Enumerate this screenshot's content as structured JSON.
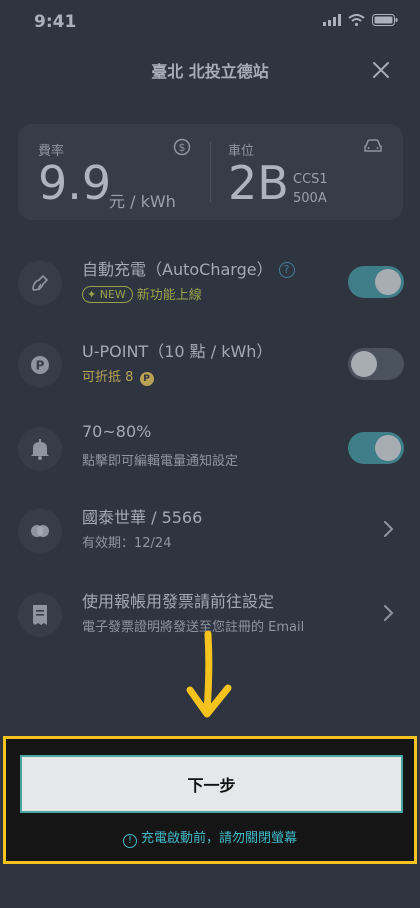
{
  "status_bar": {
    "time": "9:41"
  },
  "header": {
    "title": "臺北 北投立德站"
  },
  "info_card": {
    "rate_label": "費率",
    "rate_value": "9.9",
    "rate_unit": "元 / kWh",
    "slot_label": "車位",
    "slot_value": "2B",
    "connector_type": "CCS1",
    "connector_power": "500A"
  },
  "rows": {
    "autocharge": {
      "title": "自動充電（AutoCharge）",
      "help": "?",
      "badge": "NEW",
      "subtitle": "新功能上線",
      "toggle_on": true
    },
    "upoint": {
      "title": "U-POINT（10 點 / kWh）",
      "subtitle": "可折抵 8",
      "point_badge": "P",
      "toggle_on": false
    },
    "battery": {
      "title": "70~80%",
      "subtitle": "點擊即可編輯電量通知設定",
      "toggle_on": true
    },
    "card": {
      "title": "國泰世華 / 5566",
      "subtitle": "有效期：12/24"
    },
    "invoice": {
      "title": "使用報帳用發票請前往設定",
      "subtitle": "電子發票證明將發送至您註冊的 Email"
    }
  },
  "bottom": {
    "next_label": "下一步",
    "warning": "充電啟動前，請勿關閉螢幕",
    "warning_icon": "!"
  },
  "colors": {
    "background": "#2f3540",
    "highlight_border": "#f4c31e",
    "accent_teal": "#40b9c8",
    "toggle_on": "#3f7e88"
  }
}
